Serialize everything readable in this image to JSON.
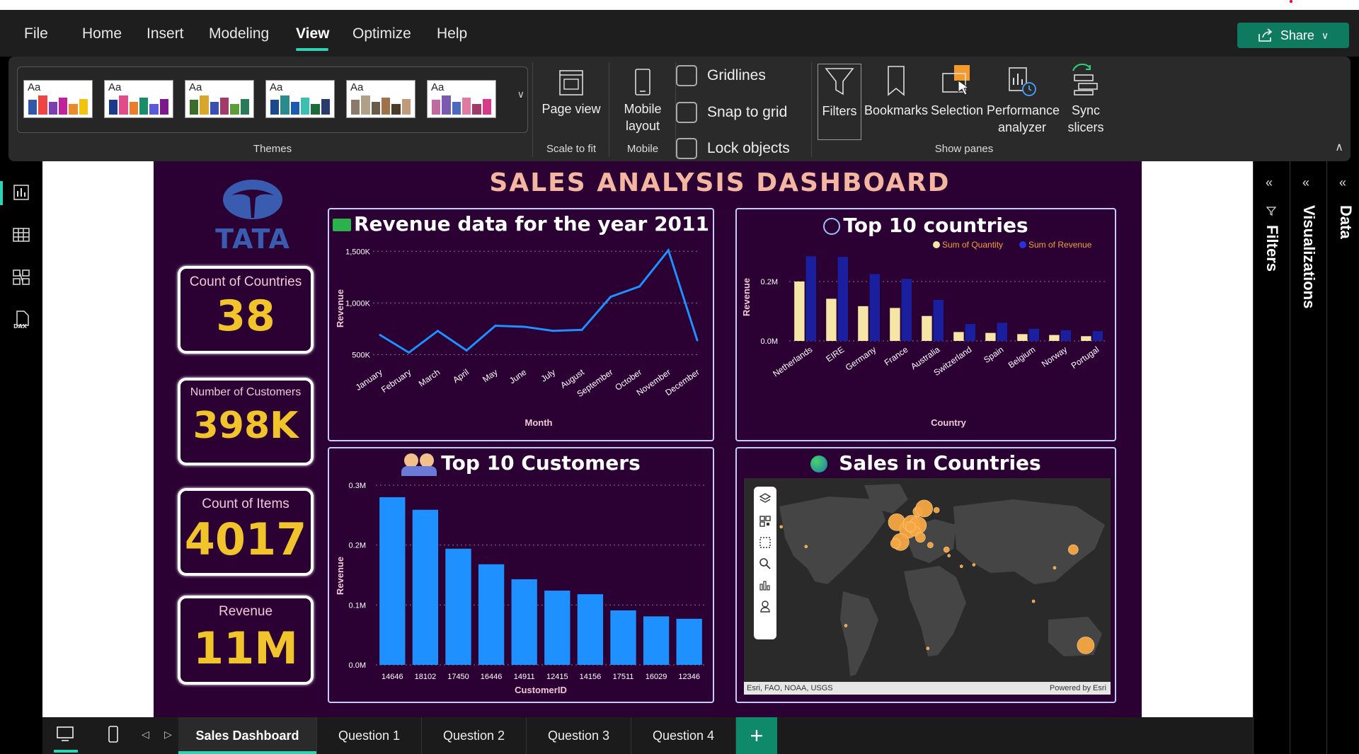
{
  "menu": {
    "items": [
      "File",
      "Home",
      "Insert",
      "Modeling",
      "View",
      "Optimize",
      "Help"
    ],
    "active": "View",
    "share_label": "Share"
  },
  "ribbon": {
    "theme_swatch_label": "Aa",
    "themes_label": "Themes",
    "page_view_label": "Page view",
    "scale_label": "Scale to fit",
    "mobile_layout_label": "Mobile layout",
    "mobile_label": "Mobile",
    "gridlines_label": "Gridlines",
    "snap_label": "Snap to grid",
    "lock_label": "Lock objects",
    "panes": [
      "Filters",
      "Bookmarks",
      "Selection",
      "Performance analyzer",
      "Sync slicers"
    ],
    "show_panes_label": "Show panes"
  },
  "dashboard": {
    "title": "SALES ANALYSIS DASHBOARD",
    "logo_text": "TATA",
    "kpis": [
      {
        "label": "Count of Countries",
        "value": "38"
      },
      {
        "label": "Number of Customers",
        "value": "398K"
      },
      {
        "label": "Count of Items",
        "value": "4017"
      },
      {
        "label": "Revenue",
        "value": "11M"
      }
    ],
    "revenue_title": "Revenue data for the year 2011",
    "countries_title": "Top 10 countries",
    "customers_title": "Top 10 Customers",
    "map_title": "Sales in Countries",
    "map_credit": "Esri, FAO, NOAA, USGS",
    "map_powered": "Powered by Esri"
  },
  "chart_data": [
    {
      "type": "line",
      "title": "Revenue data for the year 2011",
      "xlabel": "Month",
      "ylabel": "Revenue",
      "categories": [
        "January",
        "February",
        "March",
        "April",
        "May",
        "June",
        "July",
        "August",
        "September",
        "October",
        "November",
        "December"
      ],
      "values": [
        690000,
        520000,
        730000,
        540000,
        780000,
        770000,
        730000,
        740000,
        1060000,
        1160000,
        1510000,
        640000
      ],
      "yticks": [
        "500K",
        "1,000K",
        "1,500K"
      ],
      "ytick_values": [
        500000,
        1000000,
        1500000
      ],
      "ylim": [
        400000,
        1550000
      ],
      "color": "#1e90ff"
    },
    {
      "type": "bar",
      "title": "Top 10 countries",
      "xlabel": "Country",
      "ylabel": "Revenue",
      "categories": [
        "Netherlands",
        "EIRE",
        "Germany",
        "France",
        "Australia",
        "Switzerland",
        "Spain",
        "Belgium",
        "Norway",
        "Portugal"
      ],
      "series": [
        {
          "name": "Sum of Quantity",
          "color": "#f5e6a8",
          "values": [
            200000,
            142000,
            117000,
            111000,
            84000,
            30000,
            27000,
            23000,
            20000,
            16000
          ]
        },
        {
          "name": "Sum of Revenue",
          "color": "#1a1fa0",
          "values": [
            285000,
            283000,
            225000,
            209000,
            138000,
            57000,
            61000,
            41000,
            36000,
            33000
          ]
        }
      ],
      "yticks": [
        "0.0M",
        "0.2M"
      ],
      "ytick_values": [
        0,
        200000
      ],
      "ylim": [
        0,
        300000
      ],
      "legend": "top-right"
    },
    {
      "type": "bar",
      "title": "Top 10 Customers",
      "xlabel": "CustomerID",
      "ylabel": "Revenue",
      "categories": [
        "14646",
        "18102",
        "17450",
        "16446",
        "14911",
        "12415",
        "14156",
        "17511",
        "16029",
        "12346"
      ],
      "values": [
        280000,
        259000,
        194000,
        168000,
        143000,
        124000,
        118000,
        91000,
        81000,
        77000
      ],
      "yticks": [
        "0.0M",
        "0.1M",
        "0.2M",
        "0.3M"
      ],
      "ytick_values": [
        0,
        100000,
        200000,
        300000
      ],
      "ylim": [
        0,
        300000
      ],
      "color": "#1e90ff"
    }
  ],
  "map_points": [
    {
      "lon": -7,
      "lat": 53,
      "size": "large"
    },
    {
      "lon": 2,
      "lat": 48,
      "size": "large"
    },
    {
      "lon": 5,
      "lat": 52,
      "size": "large"
    },
    {
      "lon": 10,
      "lat": 51,
      "size": "large"
    },
    {
      "lon": -4,
      "lat": 40,
      "size": "large"
    },
    {
      "lon": 8,
      "lat": 47,
      "size": "medium"
    },
    {
      "lon": 4,
      "lat": 50,
      "size": "medium"
    },
    {
      "lon": 10,
      "lat": 60,
      "size": "medium"
    },
    {
      "lon": -8,
      "lat": 39,
      "size": "medium"
    },
    {
      "lon": 12,
      "lat": 43,
      "size": "medium"
    },
    {
      "lon": 15,
      "lat": 62,
      "size": "large"
    },
    {
      "lon": 25,
      "lat": 61,
      "size": "small"
    },
    {
      "lon": 33,
      "lat": 35,
      "size": "small"
    },
    {
      "lon": 135,
      "lat": 35,
      "size": "medium"
    },
    {
      "lon": 145,
      "lat": -28,
      "size": "large"
    },
    {
      "lon": -80,
      "lat": 37,
      "size": "tiny"
    },
    {
      "lon": -100,
      "lat": 50,
      "size": "tiny"
    },
    {
      "lon": -48,
      "lat": -15,
      "size": "tiny"
    },
    {
      "lon": 18,
      "lat": -30,
      "size": "tiny"
    },
    {
      "lon": 55,
      "lat": 25,
      "size": "tiny"
    },
    {
      "lon": 103,
      "lat": 1,
      "size": "tiny"
    },
    {
      "lon": 35,
      "lat": 31,
      "size": "tiny"
    },
    {
      "lon": 45,
      "lat": 24,
      "size": "tiny"
    },
    {
      "lon": 120,
      "lat": 23,
      "size": "tiny"
    },
    {
      "lon": 20,
      "lat": 38,
      "size": "small"
    }
  ],
  "right_panes": {
    "filters": "Filters",
    "visualizations": "Visualizations",
    "data": "Data"
  },
  "tabs": [
    "Sales Dashboard",
    "Question 1",
    "Question 2",
    "Question 3",
    "Question 4"
  ],
  "active_tab": "Sales Dashboard",
  "add_tab": "+",
  "colors": {
    "report_bg": "#2b0133",
    "kpi_value": "#f2c42b",
    "accent": "#2bd4b5",
    "line": "#1e90ff",
    "map_point": "#f5a742"
  },
  "icons": [
    "page-view-icon",
    "mobile-icon",
    "filter-icon",
    "bookmark-icon",
    "selection-icon",
    "performance-icon",
    "sync-slicers-icon",
    "report-view-icon",
    "table-view-icon",
    "model-view-icon",
    "dax-icon",
    "share-icon",
    "money-icon",
    "globe-icon",
    "people-icon",
    "earth-icon"
  ]
}
